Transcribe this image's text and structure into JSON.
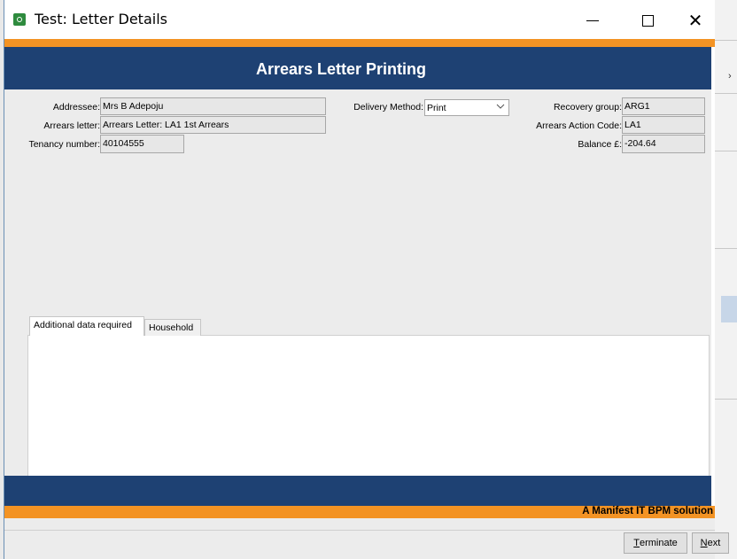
{
  "window": {
    "title": "Test: Letter Details",
    "minimize_label": "Minimize",
    "maximize_label": "Maximize",
    "close_label": "Close",
    "close_glyph": "✕"
  },
  "header": {
    "title": "Arrears Letter Printing"
  },
  "form": {
    "addressee": {
      "label": "Addressee:",
      "value": "Mrs B Adepoju"
    },
    "arrears_letter": {
      "label": "Arrears letter:",
      "value": "Arrears Letter: LA1 1st Arrears"
    },
    "tenancy_number": {
      "label": "Tenancy number:",
      "value": "40104555"
    },
    "delivery_method": {
      "label": "Delivery Method:",
      "value": "Print"
    },
    "recovery_group": {
      "label": "Recovery group:",
      "value": "ARG1"
    },
    "arrears_action_code": {
      "label": "Arrears Action Code:",
      "value": "LA1"
    },
    "balance": {
      "label": "Balance £:",
      "value": "-204.64"
    }
  },
  "tabs": [
    {
      "label": "Additional data required",
      "active": true
    },
    {
      "label": "Household",
      "active": false
    }
  ],
  "footer": {
    "tagline": "A Manifest IT BPM solution"
  },
  "buttons": {
    "terminate_first": "T",
    "terminate_rest": "erminate",
    "next_first": "N",
    "next_rest": "ext"
  },
  "colors": {
    "navy": "#1e4173",
    "orange": "#f39324"
  }
}
